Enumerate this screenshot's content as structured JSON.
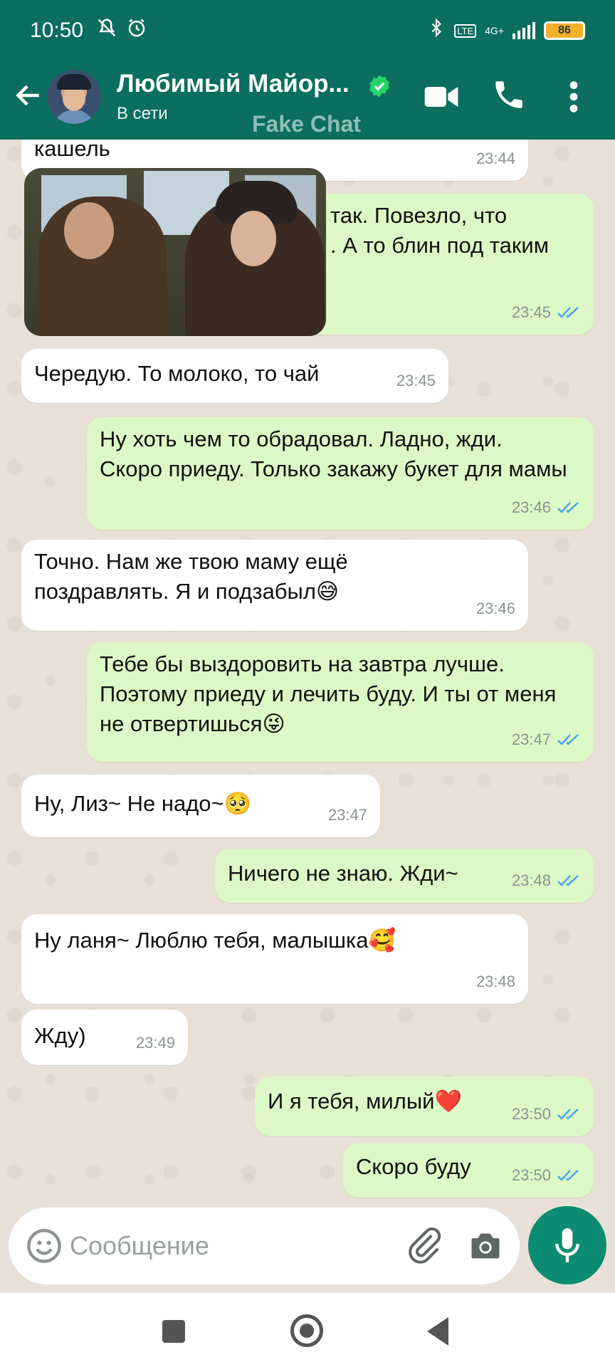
{
  "status_bar": {
    "time": "10:50",
    "network_badge": "LTE",
    "network_type": "4G+",
    "battery": "86",
    "icons": [
      "mute-icon",
      "alarm-icon",
      "bluetooth-icon",
      "signal-icon",
      "battery-icon"
    ]
  },
  "header": {
    "contact_name": "Любимый Майор...",
    "status": "В сети",
    "watermark": "Fake Chat",
    "icons": [
      "back-arrow-icon",
      "verified-icon",
      "video-call-icon",
      "voice-call-icon",
      "more-vert-icon"
    ]
  },
  "messages": [
    {
      "direction": "in",
      "text": "кашель",
      "time": "23:44"
    },
    {
      "direction": "out",
      "text": "так. Повезло, что\n. А то блин под таким",
      "time": "23:45",
      "has_photo": true
    },
    {
      "direction": "in",
      "text": "Чередую. То молоко, то чай",
      "time": "23:45"
    },
    {
      "direction": "out",
      "text": "Ну хоть чем то обрадовал. Ладно, жди. Скоро приеду. Только закажу букет для мамы",
      "time": "23:46"
    },
    {
      "direction": "in",
      "text": "Точно. Нам же твою маму ещё поздравлять. Я и подзабыл😅",
      "time": "23:46"
    },
    {
      "direction": "out",
      "text": "Тебе бы выздоровить на завтра лучше. Поэтому приеду и лечить буду. И ты от меня не отвертишься😜",
      "time": "23:47"
    },
    {
      "direction": "in",
      "text": "Ну, Лиз~ Не надо~🥺",
      "time": "23:47"
    },
    {
      "direction": "out",
      "text": "Ничего не знаю. Жди~",
      "time": "23:48"
    },
    {
      "direction": "in",
      "text": "Ну ланя~ Люблю тебя, малышка🥰",
      "time": "23:48"
    },
    {
      "direction": "in",
      "text": "Жду)",
      "time": "23:49"
    },
    {
      "direction": "out",
      "text": "И я тебя, милый❤️",
      "time": "23:50"
    },
    {
      "direction": "out",
      "text": "Скоро буду",
      "time": "23:50"
    }
  ],
  "colors": {
    "header": "#0b6e5f",
    "outgoing_bubble": "#dcf8c6",
    "incoming_bubble": "#ffffff",
    "read_ticks": "#4fa8e6",
    "mic_button": "#0b8c73"
  },
  "input": {
    "placeholder": "Сообщение",
    "icons": [
      "emoji-icon",
      "attach-icon",
      "camera-icon",
      "mic-icon"
    ]
  },
  "nav_bar": {
    "icons": [
      "recents-square-icon",
      "home-circle-icon",
      "back-triangle-icon"
    ]
  }
}
